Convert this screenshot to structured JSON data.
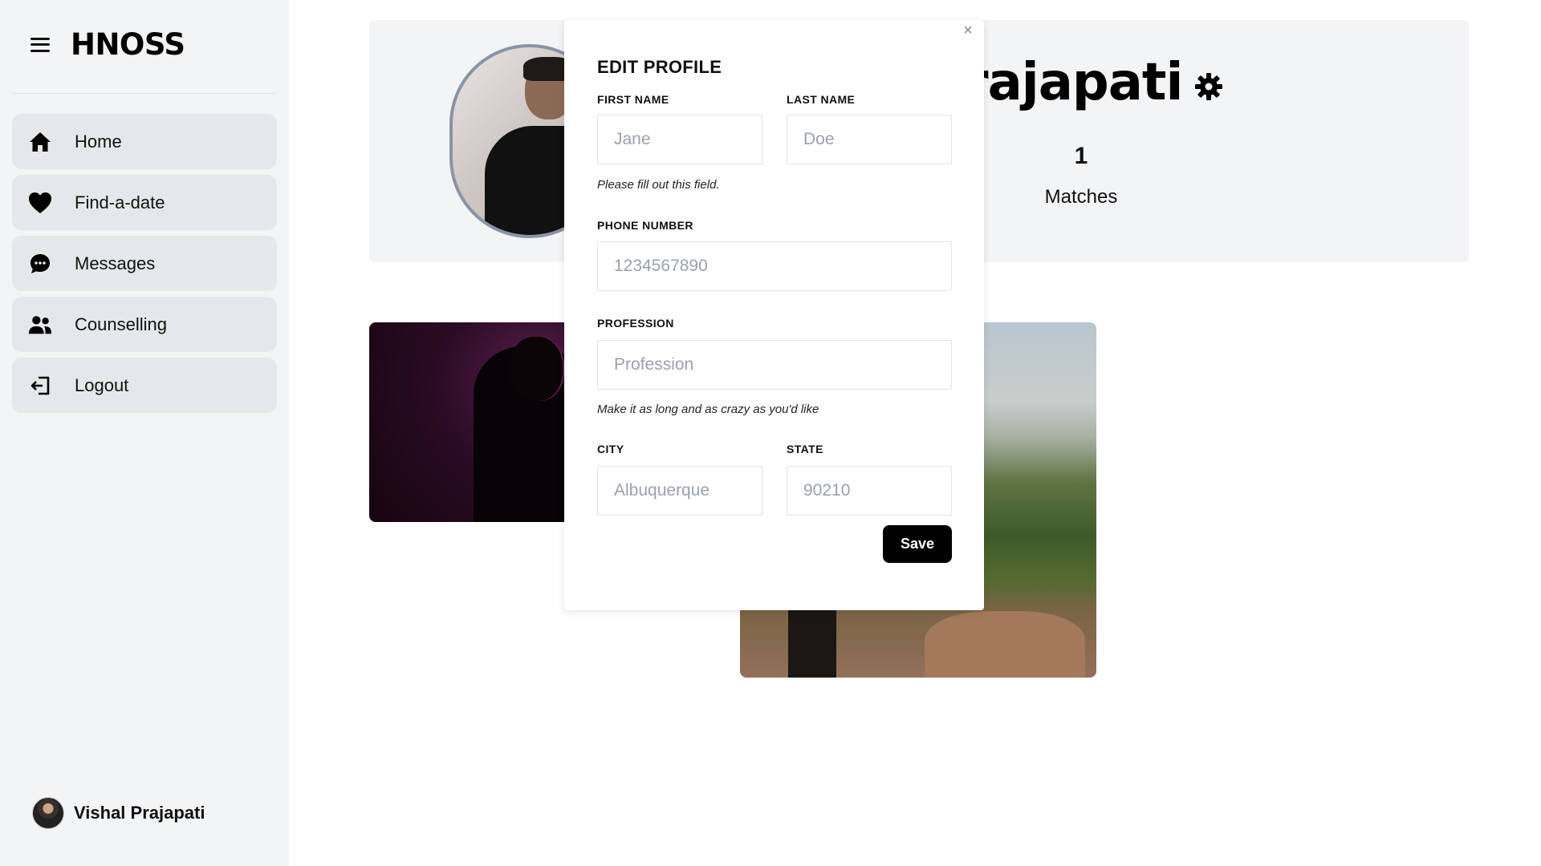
{
  "sidebar": {
    "brand": "HNOSS",
    "items": [
      {
        "label": "Home",
        "icon": "home-icon"
      },
      {
        "label": "Find-a-date",
        "icon": "heart-icon"
      },
      {
        "label": "Messages",
        "icon": "chat-bubble-icon"
      },
      {
        "label": "Counselling",
        "icon": "users-icon"
      },
      {
        "label": "Logout",
        "icon": "logout-icon"
      }
    ],
    "user_name": "Vishal Prajapati"
  },
  "profile": {
    "name_visible": "rajapati",
    "matches_count": "1",
    "matches_label": "Matches"
  },
  "modal": {
    "title": "EDIT PROFILE",
    "close_glyph": "×",
    "first_name": {
      "label": "FIRST NAME",
      "placeholder": "Jane",
      "hint": "Please fill out this field."
    },
    "last_name": {
      "label": "LAST NAME",
      "placeholder": "Doe"
    },
    "phone": {
      "label": "PHONE NUMBER",
      "placeholder": "1234567890"
    },
    "profession": {
      "label": "PROFESSION",
      "placeholder": "Profession",
      "hint": "Make it as long and as crazy as you'd like"
    },
    "city": {
      "label": "CITY",
      "placeholder": "Albuquerque"
    },
    "state": {
      "label": "STATE",
      "placeholder": "90210"
    },
    "save_label": "Save"
  },
  "colors": {
    "sidebar_bg": "#f3f4f6",
    "nav_item_bg": "#e5e7eb",
    "card_bg": "#f3f4f6",
    "button_bg": "#000000",
    "avatar_border": "#8a94a6"
  }
}
